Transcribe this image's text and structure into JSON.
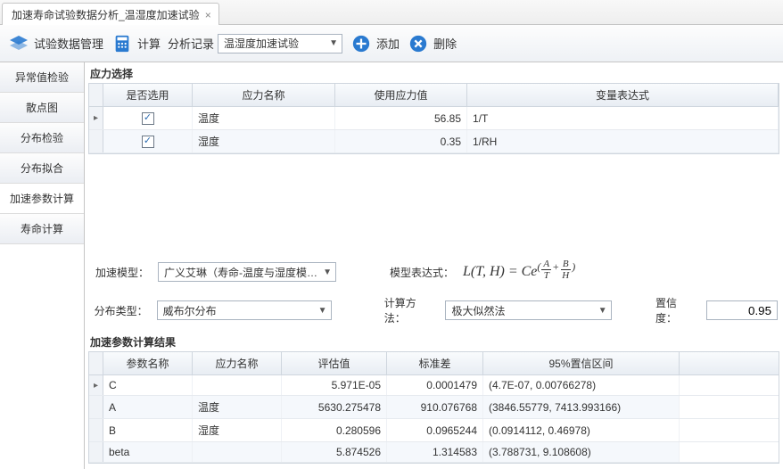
{
  "tab": {
    "title": "加速寿命试验数据分析_温湿度加速试验"
  },
  "toolbar": {
    "data_mgmt": "试验数据管理",
    "compute": "计算",
    "record_label": "分析记录",
    "record_value": "温湿度加速试验",
    "add": "添加",
    "delete": "删除"
  },
  "side": {
    "items": [
      "异常值检验",
      "散点图",
      "分布检验",
      "分布拟合",
      "加速参数计算",
      "寿命计算"
    ],
    "active_index": 4
  },
  "stress": {
    "title": "应力选择",
    "headers": {
      "sel": "是否选用",
      "name": "应力名称",
      "value": "使用应力值",
      "expr": "变量表达式"
    },
    "rows": [
      {
        "checked": true,
        "name": "温度",
        "value": "56.85",
        "expr": "1/T"
      },
      {
        "checked": true,
        "name": "湿度",
        "value": "0.35",
        "expr": "1/RH"
      }
    ]
  },
  "model": {
    "label": "加速模型：",
    "value": "广义艾琳（寿命-温度与湿度模…",
    "expr_label": "模型表达式："
  },
  "dist": {
    "label": "分布类型：",
    "value": "威布尔分布",
    "method_label": "计算方法：",
    "method_value": "极大似然法",
    "conf_label": "置信度：",
    "conf_value": "0.95"
  },
  "results": {
    "title": "加速参数计算结果",
    "headers": {
      "param": "参数名称",
      "stress": "应力名称",
      "est": "评估值",
      "se": "标准差",
      "ci": "95%置信区间"
    },
    "rows": [
      {
        "param": "C",
        "stress": "",
        "est": "5.971E-05",
        "se": "0.0001479",
        "ci": "(4.7E-07, 0.00766278)"
      },
      {
        "param": "A",
        "stress": "温度",
        "est": "5630.275478",
        "se": "910.076768",
        "ci": "(3846.55779, 7413.993166)"
      },
      {
        "param": "B",
        "stress": "湿度",
        "est": "0.280596",
        "se": "0.0965244",
        "ci": "(0.0914112, 0.46978)"
      },
      {
        "param": "beta",
        "stress": "",
        "est": "5.874526",
        "se": "1.314583",
        "ci": "(3.788731, 9.108608)"
      }
    ]
  },
  "chart_data": {
    "type": "table",
    "title": "加速参数计算结果",
    "columns": [
      "参数名称",
      "应力名称",
      "评估值",
      "标准差",
      "95%置信区间"
    ],
    "rows": [
      [
        "C",
        "",
        5.971e-05,
        0.0001479,
        "(4.7E-07, 0.00766278)"
      ],
      [
        "A",
        "温度",
        5630.275478,
        910.076768,
        "(3846.55779, 7413.993166)"
      ],
      [
        "B",
        "湿度",
        0.280596,
        0.0965244,
        "(0.0914112, 0.46978)"
      ],
      [
        "beta",
        "",
        5.874526,
        1.314583,
        "(3.788731, 9.108608)"
      ]
    ]
  }
}
